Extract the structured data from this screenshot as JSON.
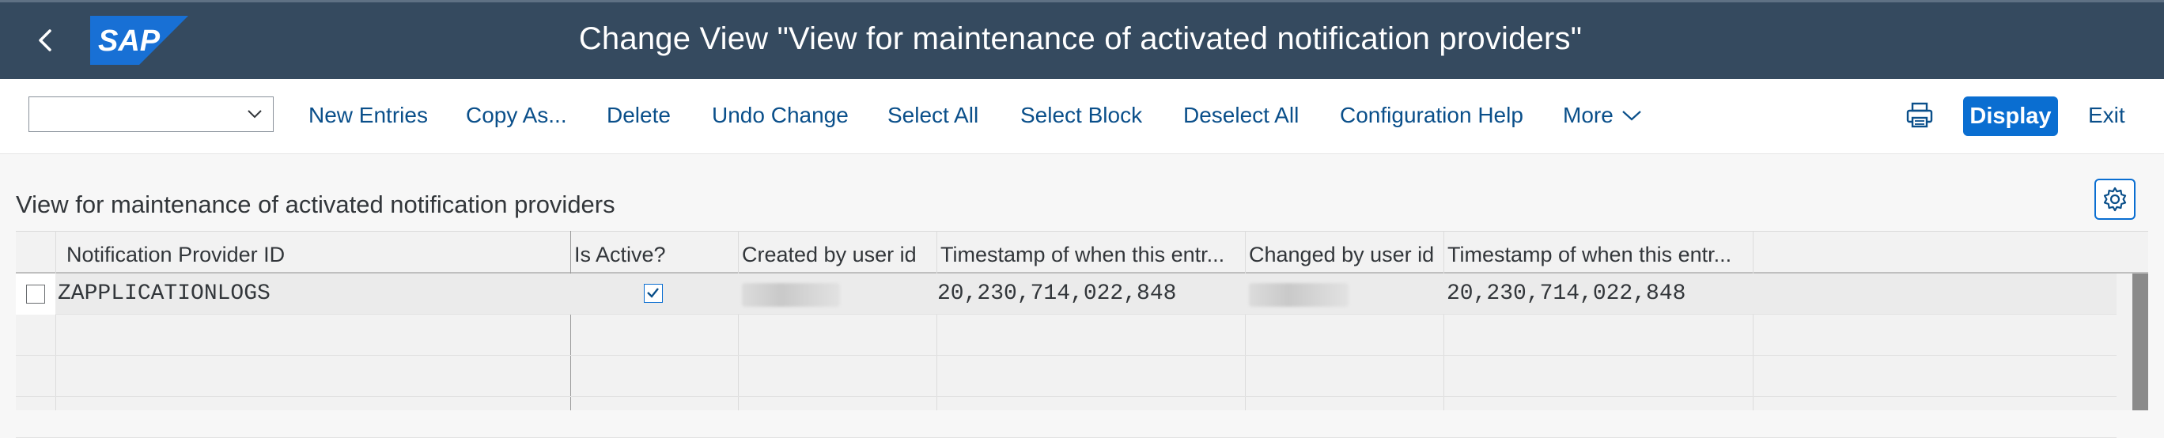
{
  "shell": {
    "title": "Change View \"View for maintenance of activated notification providers\"",
    "logo_text": "SAP",
    "colors": {
      "bar": "#354a5f",
      "logo": "#1870d5"
    }
  },
  "toolbar": {
    "select_value": "",
    "new_entries": "New Entries",
    "copy_as": "Copy As...",
    "delete": "Delete",
    "undo_change": "Undo Change",
    "select_all": "Select All",
    "select_block": "Select Block",
    "deselect_all": "Deselect All",
    "configuration_help": "Configuration Help",
    "more": "More",
    "display": "Display",
    "exit": "Exit",
    "accent": "#0a6ed1"
  },
  "content": {
    "view_title": "View for maintenance of activated notification providers"
  },
  "table": {
    "columns": [
      "Notification Provider ID",
      "Is Active?",
      "Created by user id",
      "Timestamp of when this entr...",
      "Changed by user id",
      "Timestamp of when this entr..."
    ],
    "rows": [
      {
        "selected": false,
        "provider_id": "ZAPPLICATIONLOGS",
        "is_active": true,
        "created_by": "",
        "created_ts": "20,230,714,022,848",
        "changed_by": "",
        "changed_ts": "20,230,714,022,848"
      }
    ]
  }
}
